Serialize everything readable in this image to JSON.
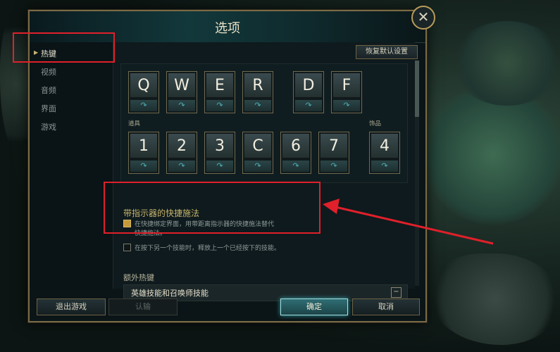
{
  "window": {
    "title": "选项"
  },
  "sidebar": {
    "items": [
      {
        "label": "热键",
        "active": true
      },
      {
        "label": "视频",
        "active": false
      },
      {
        "label": "音频",
        "active": false
      },
      {
        "label": "界面",
        "active": false
      },
      {
        "label": "游戏",
        "active": false
      }
    ]
  },
  "toolbar": {
    "reset_label": "恢复默认设置"
  },
  "hotkeys": {
    "ability_keys": [
      "Q",
      "W",
      "E",
      "R"
    ],
    "summoner_keys": [
      "D",
      "F"
    ],
    "items_label": "道具",
    "item_keys": [
      "1",
      "2",
      "3",
      "C",
      "6",
      "7"
    ],
    "trinket_label": "饰品",
    "trinket_key": "4",
    "sub_glyph": "↷"
  },
  "options": {
    "quickcast_title": "带指示器的快捷施法",
    "quickcast_desc_1": "在快捷绑定界面，用带距离指示器的快捷施法替代",
    "quickcast_desc_2": "快捷施法。",
    "quickcast_checked": true,
    "secondary_desc": "在按下另一个技能时，释放上一个已经按下的技能。",
    "secondary_checked": false
  },
  "extra": {
    "section_label": "额外热键",
    "bar_label": "英雄技能和召唤师技能",
    "collapse_symbol": "−"
  },
  "footer": {
    "exit_label": "退出游戏",
    "surrender_label": "认输",
    "ok_label": "确定",
    "cancel_label": "取消"
  },
  "colors": {
    "annotation": "#e0202a",
    "accent_gold": "#c8b56c"
  }
}
